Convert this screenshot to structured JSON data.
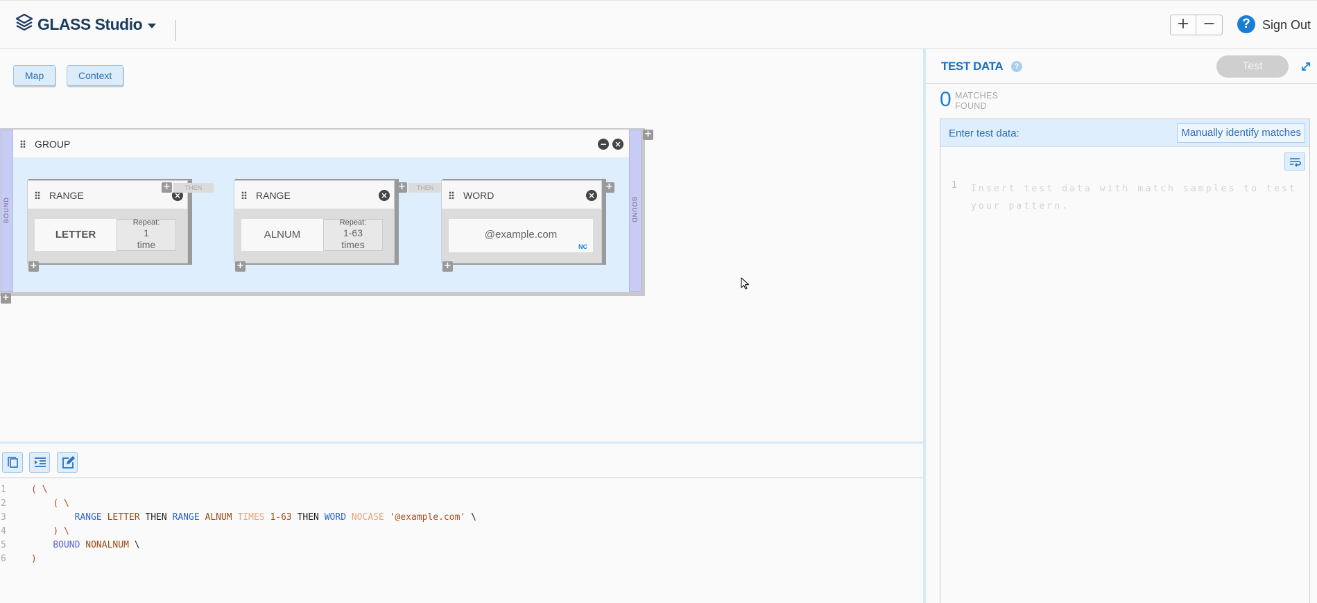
{
  "header": {
    "app_title": "GLASS Studio",
    "zoom_in_label": "+",
    "zoom_out_label": "−",
    "help_label": "?",
    "sign_out_label": "Sign Out"
  },
  "view_tabs": {
    "map_label": "Map",
    "context_label": "Context"
  },
  "canvas": {
    "group": {
      "title": "GROUP",
      "bound_left_label": "BOUND",
      "bound_right_label": "BOUND",
      "nodes": [
        {
          "title": "RANGE",
          "token": "LETTER",
          "repeat_label": "Repeat:",
          "repeat_value_line1": "1",
          "repeat_value_line2": "time"
        },
        {
          "title": "RANGE",
          "token": "ALNUM",
          "repeat_label": "Repeat:",
          "repeat_value_line1": "1-63",
          "repeat_value_line2": "times"
        },
        {
          "title": "WORD",
          "token": "@example.com",
          "badge": "NC"
        }
      ],
      "then_labels": [
        "THEN",
        "THEN"
      ]
    },
    "add_label": "+"
  },
  "code": {
    "line_numbers": [
      "1",
      "2",
      "3",
      "4",
      "5",
      "6"
    ],
    "l1_paren": "( \\",
    "l2_paren": "( \\",
    "l3_range1": "RANGE",
    "l3_letter": "LETTER",
    "l3_then1": "THEN",
    "l3_range2": "RANGE",
    "l3_alnum": "ALNUM",
    "l3_times": "TIMES",
    "l3_count": "1-63",
    "l3_then2": "THEN",
    "l3_word": "WORD",
    "l3_nocase": "NOCASE",
    "l3_string": "'@example.com'",
    "l3_cont": "\\",
    "l4_paren": ") \\",
    "l5_bound": "BOUND",
    "l5_nonalnum": "NONALNUM",
    "l5_cont": "\\",
    "l6_paren": ")"
  },
  "test_panel": {
    "title": "TEST DATA",
    "help_label": "?",
    "test_button": "Test",
    "matches_count": "0",
    "matches_label_line1": "MATCHES",
    "matches_label_line2": "FOUND",
    "enter_label": "Enter test data:",
    "manual_button": "Manually identify matches",
    "editor_line_number": "1",
    "editor_placeholder": "Insert test data with match samples to test your pattern."
  },
  "colors": {
    "brand": "#1d3b5e",
    "accent": "#1a7fd4",
    "panel_tint": "#dfeefc",
    "bound_strip": "#c8ccf4"
  }
}
